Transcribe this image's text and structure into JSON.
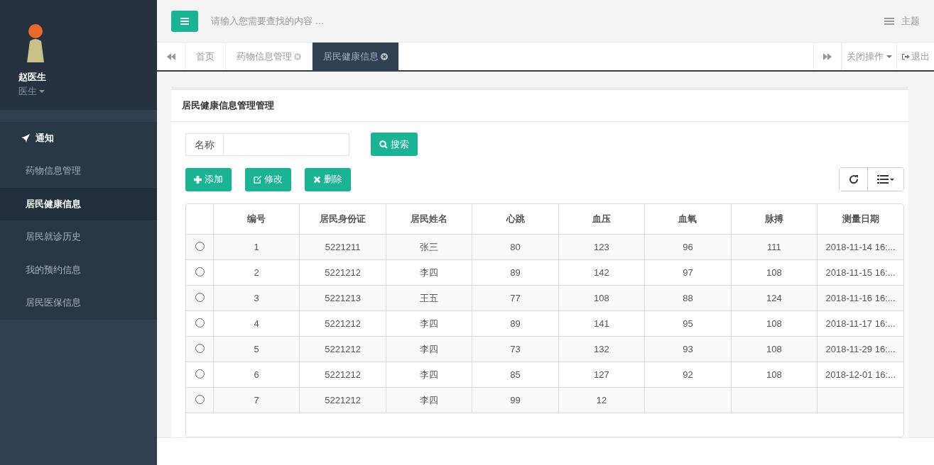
{
  "user": {
    "name": "赵医生",
    "role": "医生"
  },
  "sidebar": {
    "items": [
      {
        "label": "通知",
        "kind": "header"
      },
      {
        "label": "药物信息管理",
        "kind": "item",
        "selected": false
      },
      {
        "label": "居民健康信息",
        "kind": "item",
        "selected": true
      },
      {
        "label": "居民就诊历史",
        "kind": "item",
        "selected": false
      },
      {
        "label": "我的预约信息",
        "kind": "item",
        "selected": false
      },
      {
        "label": "居民医保信息",
        "kind": "item",
        "selected": false
      }
    ]
  },
  "topbar": {
    "search_placeholder": "请输入您需要查找的内容 …",
    "theme": "主题"
  },
  "tabs": [
    {
      "label": "首页",
      "closable": false,
      "selected": false
    },
    {
      "label": "药物信息管理",
      "closable": true,
      "selected": false
    },
    {
      "label": "居民健康信息",
      "closable": true,
      "selected": true
    }
  ],
  "tab_actions": {
    "close_menu": "关闭操作",
    "logout": "退出"
  },
  "panel": {
    "title": "居民健康信息管理管理",
    "filter": {
      "label": "名称",
      "search_button": "搜索"
    },
    "buttons": [
      {
        "kind": "add",
        "label": "添加"
      },
      {
        "kind": "edit",
        "label": "修改"
      },
      {
        "kind": "delete",
        "label": "删除"
      }
    ]
  },
  "table": {
    "columns": [
      "编号",
      "居民身份证",
      "居民姓名",
      "心跳",
      "血压",
      "血氧",
      "脉搏",
      "测量日期"
    ],
    "rows": [
      {
        "selected": false,
        "cells": [
          "1",
          "5221211",
          "张三",
          "80",
          "123",
          "96",
          "111",
          "2018-11-14 16:..."
        ]
      },
      {
        "selected": false,
        "cells": [
          "2",
          "5221212",
          "李四",
          "89",
          "142",
          "97",
          "108",
          "2018-11-15 16:..."
        ]
      },
      {
        "selected": false,
        "cells": [
          "3",
          "5221213",
          "王五",
          "77",
          "108",
          "88",
          "124",
          "2018-11-16 16:..."
        ]
      },
      {
        "selected": false,
        "cells": [
          "4",
          "5221212",
          "李四",
          "89",
          "141",
          "95",
          "108",
          "2018-11-17 16:..."
        ]
      },
      {
        "selected": false,
        "cells": [
          "5",
          "5221212",
          "李四",
          "73",
          "132",
          "93",
          "108",
          "2018-11-29 16:..."
        ]
      },
      {
        "selected": false,
        "cells": [
          "6",
          "5221212",
          "李四",
          "85",
          "127",
          "92",
          "108",
          "2018-12-01 16:..."
        ]
      },
      {
        "selected": false,
        "cells": [
          "7",
          "5221212",
          "李四",
          "99",
          "12"
        ]
      }
    ]
  }
}
